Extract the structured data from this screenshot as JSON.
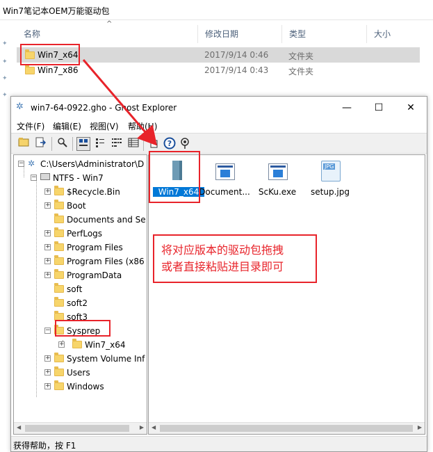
{
  "background_window": {
    "title": "Win7笔记本OEM万能驱动包",
    "columns": [
      "名称",
      "修改日期",
      "类型",
      "大小"
    ],
    "rows": [
      {
        "name": "Win7_x64",
        "date": "2017/9/14 0:46",
        "type": "文件夹",
        "selected": true
      },
      {
        "name": "Win7_x86",
        "date": "2017/9/14 0:43",
        "type": "文件夹",
        "selected": false
      }
    ]
  },
  "ghost_window": {
    "title": "win7-64-0922.gho - Ghost Explorer",
    "controls": {
      "minimize": "—",
      "maximize": "☐",
      "close": "✕"
    },
    "menu": [
      "文件(F)",
      "编辑(E)",
      "视图(V)",
      "帮助(H)"
    ],
    "tree": {
      "root": "C:\\Users\\Administrator\\D",
      "volume": "NTFS - Win7",
      "folders": [
        "$Recycle.Bin",
        "Boot",
        "Documents and Se",
        "PerfLogs",
        "Program Files",
        "Program Files (x86",
        "ProgramData",
        "soft",
        "soft2",
        "soft3",
        "Sysprep",
        "System Volume Inf",
        "Users",
        "Windows"
      ],
      "sysprep_child": "Win7_x64"
    },
    "files": [
      {
        "name": "Win7_x64",
        "icon": "folder-icon",
        "selected": true
      },
      {
        "name": "Document...",
        "icon": "document-window-icon",
        "selected": false
      },
      {
        "name": "ScKu.exe",
        "icon": "executable-icon",
        "selected": false
      },
      {
        "name": "setup.jpg",
        "icon": "jpg-image-icon",
        "jpg_badge": "JPG",
        "selected": false
      }
    ],
    "status": "获得帮助，按 F1"
  },
  "annotation": {
    "note_line1": "将对应版本的驱动包拖拽",
    "note_line2": "或者直接粘贴进目录即可",
    "color": "#e8232a"
  },
  "colors": {
    "selection": "#0078d7",
    "folder": "#f7d56b",
    "annotation_red": "#e8232a"
  }
}
